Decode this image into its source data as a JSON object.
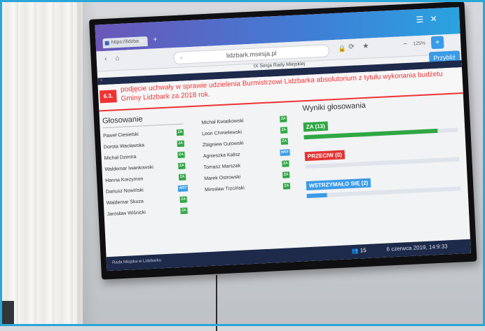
{
  "browser": {
    "tab_title": "https://lidzba",
    "tab_close": "×",
    "new_tab": "+",
    "url": "lidzbark.msesja.pl",
    "zoom_minus": "−",
    "zoom_level": "125%",
    "zoom_plus": "+",
    "zoom_button_label": "Przybliż",
    "page_header": "IX Sesja Rady Miejskiej"
  },
  "agenda": {
    "number": "6.3.",
    "text": "podjęcie uchwały w sprawie udzielenia Burmistrzowi Lidzbarka absolutorium z tytułu wykonania budżetu Gminy Lidzbark za 2018 rok."
  },
  "voting": {
    "title": "Głosowanie",
    "za_label": "ZA",
    "wst_label": "WST",
    "left_column": [
      {
        "name": "Paweł Ciesielski",
        "vote": "ZA"
      },
      {
        "name": "Dorota Wacławska",
        "vote": "ZA"
      },
      {
        "name": "Michał Dzimira",
        "vote": "ZA"
      },
      {
        "name": "Waldemar Iwankowski",
        "vote": "ZA"
      },
      {
        "name": "Hanna Krezymon",
        "vote": "ZA"
      },
      {
        "name": "Dariusz Nowiński",
        "vote": "WST"
      },
      {
        "name": "Waldemar Skuza",
        "vote": "ZA"
      },
      {
        "name": "Jarosław Wiśnicki",
        "vote": "ZA"
      }
    ],
    "right_column": [
      {
        "name": "Michał Kwiatkowski",
        "vote": "ZA"
      },
      {
        "name": "Leon Chmielewski",
        "vote": "ZA"
      },
      {
        "name": "Zbigniew Gutowski",
        "vote": "ZA"
      },
      {
        "name": "Agnieszka Kalisz",
        "vote": "WST"
      },
      {
        "name": "Tomasz Marszak",
        "vote": "ZA"
      },
      {
        "name": "Marek Ostrowski",
        "vote": "ZA"
      },
      {
        "name": "Mirosław Trzciński",
        "vote": "ZA"
      }
    ]
  },
  "results": {
    "title": "Wyniki głosowania",
    "items": [
      {
        "label": "ZA (13)",
        "color": "#2fa843",
        "fraction": 0.87
      },
      {
        "label": "PRZECIW (0)",
        "color": "#e33333",
        "fraction": 0
      },
      {
        "label": "WSTRZYMAŁO SIĘ (2)",
        "color": "#3a9be6",
        "fraction": 0.13
      }
    ]
  },
  "footer": {
    "org_name": "Rada Miejska w Lidzbarku",
    "present_count": "15",
    "datetime": "6 czerwca 2019, 14:9:33"
  }
}
